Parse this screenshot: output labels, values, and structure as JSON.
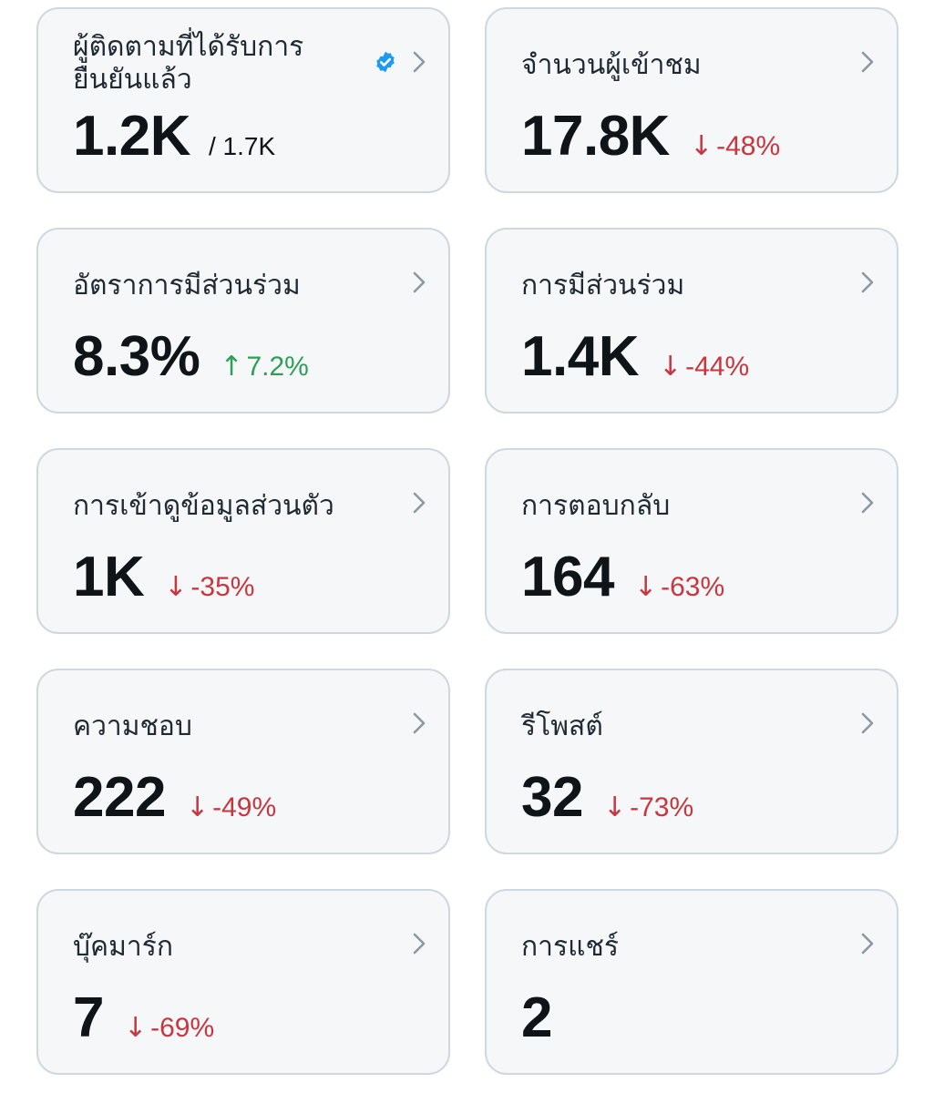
{
  "colors": {
    "card_background": "#f5f7f9",
    "card_border": "#cfd8df",
    "value_text": "#0f1419",
    "negative_change": "#c8373f",
    "positive_change": "#2e9e58",
    "verified_badge": "#1d9bf0",
    "chevron": "#8b98a5"
  },
  "cards": [
    {
      "title_line1": "ผู้ติดตามที่ได้รับการ",
      "title_line2": "ยืนยันแล้ว",
      "value": "1.2K",
      "total": "/ 1.7K",
      "icon": "verified-badge-icon"
    },
    {
      "title": "จำนวนผู้เข้าชม",
      "value": "17.8K",
      "arrow": "↓",
      "change": "-48%",
      "trend": "down"
    },
    {
      "title": "อัตราการมีส่วนร่วม",
      "value": "8.3%",
      "arrow": "↑",
      "change": "7.2%",
      "trend": "up"
    },
    {
      "title": "การมีส่วนร่วม",
      "value": "1.4K",
      "arrow": "↓",
      "change": "-44%",
      "trend": "down"
    },
    {
      "title": "การเข้าดูข้อมูลส่วนตัว",
      "value": "1K",
      "arrow": "↓",
      "change": "-35%",
      "trend": "down"
    },
    {
      "title": "การตอบกลับ",
      "value": "164",
      "arrow": "↓",
      "change": "-63%",
      "trend": "down"
    },
    {
      "title": "ความชอบ",
      "value": "222",
      "arrow": "↓",
      "change": "-49%",
      "trend": "down"
    },
    {
      "title": "รีโพสต์",
      "value": "32",
      "arrow": "↓",
      "change": "-73%",
      "trend": "down"
    },
    {
      "title": "บุ๊คมาร์ก",
      "value": "7",
      "arrow": "↓",
      "change": "-69%",
      "trend": "down"
    },
    {
      "title": "การแชร์",
      "value": "2"
    }
  ]
}
